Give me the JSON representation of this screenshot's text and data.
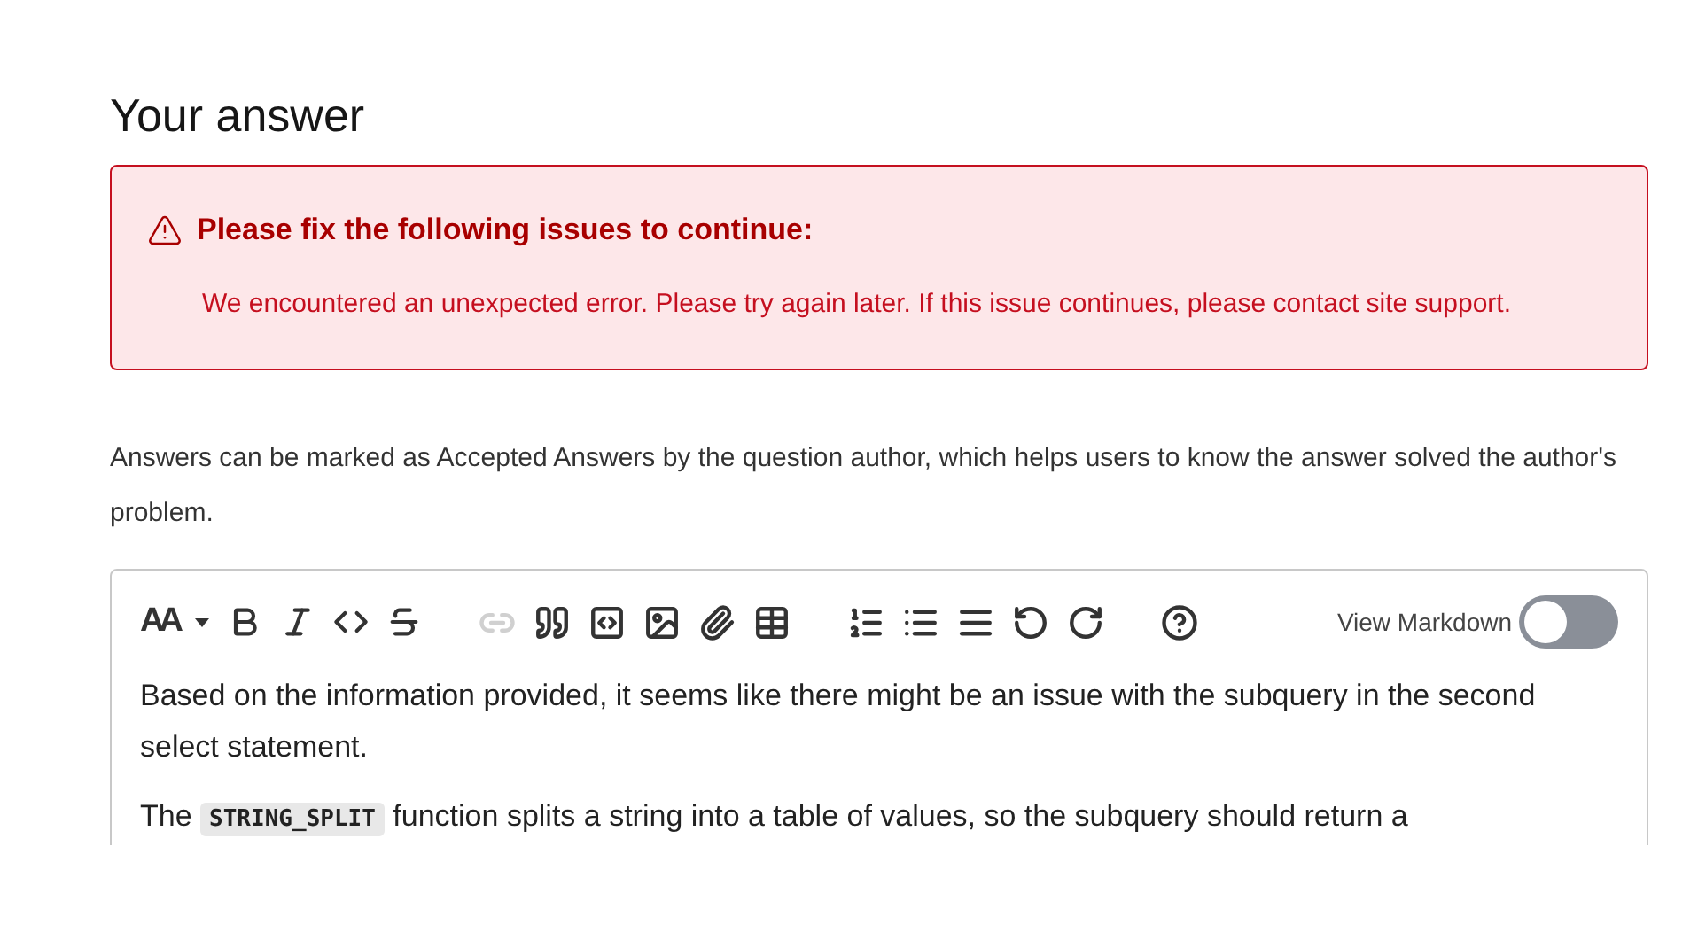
{
  "title": "Your answer",
  "alert": {
    "heading": "Please fix the following issues to continue:",
    "message": "We encountered an unexpected error. Please try again later. If this issue continues, please contact site support."
  },
  "help_text": "Answers can be marked as Accepted Answers by the question author, which helps users to know the answer solved the author's problem.",
  "editor": {
    "toolbar": {
      "heading_label": "AA",
      "groups": [
        [
          {
            "kind": "bold",
            "disabled": false
          },
          {
            "kind": "italic",
            "disabled": false
          },
          {
            "kind": "code",
            "disabled": false
          },
          {
            "kind": "strike",
            "disabled": false
          }
        ],
        [
          {
            "kind": "link",
            "disabled": true
          },
          {
            "kind": "quote",
            "disabled": false
          },
          {
            "kind": "codeblock",
            "disabled": false
          },
          {
            "kind": "image",
            "disabled": false
          },
          {
            "kind": "attach",
            "disabled": false
          },
          {
            "kind": "table",
            "disabled": false
          }
        ],
        [
          {
            "kind": "olist",
            "disabled": false
          },
          {
            "kind": "ulist",
            "disabled": false
          },
          {
            "kind": "rule",
            "disabled": false
          },
          {
            "kind": "undo",
            "disabled": false
          },
          {
            "kind": "redo",
            "disabled": false
          }
        ],
        [
          {
            "kind": "help",
            "disabled": false
          }
        ]
      ],
      "view_markdown": {
        "label": "View Markdown",
        "on": false
      }
    },
    "paragraphs": [
      [
        {
          "kind": "text",
          "text": "Based on the information provided, it seems like there might be an issue with the subquery in the second select statement."
        }
      ],
      [
        {
          "kind": "text",
          "text": "The "
        },
        {
          "kind": "code",
          "text": "STRING_SPLIT"
        },
        {
          "kind": "text",
          "text": " function splits a string into a table of values, so the subquery should return a"
        }
      ]
    ]
  }
}
